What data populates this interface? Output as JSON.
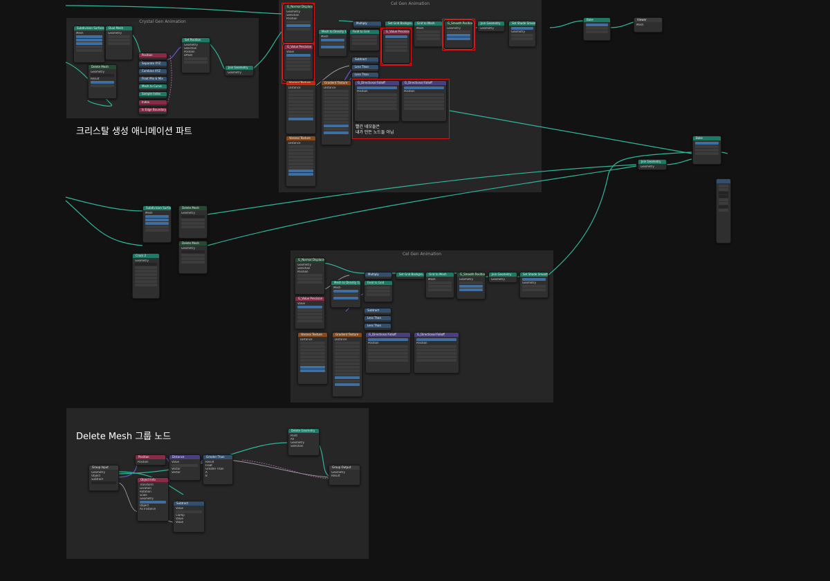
{
  "frames": {
    "crystal": {
      "title": "Crystal Gen Animation"
    },
    "cel_top": {
      "title": "Cel Gen Animation"
    },
    "cel_mid": {
      "title": "Cel Gen Animation"
    },
    "delete_mesh": {
      "title": ""
    }
  },
  "labels": {
    "crystal_caption": "크리스탈 생성 애니메이션 파트",
    "delete_caption": "Delete Mesh 그룹 노드",
    "red_note_line1": "빨간 네모들은",
    "red_note_line2": "내가 만든 노드들 아님"
  },
  "nodes": {
    "subdiv1": "Subdivision Surface",
    "dual_mesh1": "Dual Mesh",
    "delete_mesh1": "Delete Mesh",
    "position1": "Position",
    "separate_xyz": "Separate XYZ",
    "combine_xyz": "Combine XYZ",
    "float_mix": "Float Mix & Mix",
    "mesh_to_curve": "Mesh to Curve",
    "sample_index": "Sample Index",
    "index1": "Index",
    "is_edge_boundary": "Is Edge Boundary",
    "set_position": "Set Position",
    "join_geometry1": "Join Geometry",
    "g_normal_displace_top": "G_Normal Displace",
    "g_value_precision_top": "G_Value Precision",
    "mesh_to_density_top": "Mesh to Density G..",
    "field_to_grid_top": "Field to Grid",
    "g_value_precision2_top": "G_Value Precision",
    "multiply_top": "Multiply",
    "set_grid_background_top": "Set Grid Backgro..",
    "grid_to_mesh_top": "Grid to Mesh",
    "g_smooth_position_top": "G_Smooth Position",
    "join_geometry_top": "Join Geometry",
    "set_shade_smooth_top": "Set Shade Smooth",
    "subtract_top": "Subtract",
    "less_than_top": "Less Than",
    "less_than2_top": "Less Than",
    "g_directional_falloff1": "G_Directional Falloff",
    "g_directional_falloff2": "G_Directional Falloff",
    "voronoi_top": "Voronoi Texture",
    "gradient_top": "Gradient Texture",
    "voronoi2_top": "Voronoi Texture",
    "bake": "Bake",
    "viewer": "Viewer",
    "bake2": "Bake",
    "join_geometry_right": "Join Geometry",
    "subdiv2": "Subdivision Surface",
    "delete_mesh2": "Delete Mesh",
    "crack2": "Crack 2",
    "delete_mesh3": "Delete Mesh",
    "g_normal_displace_mid": "G_Normal Displace",
    "g_value_precision_mid": "G_Value Precision",
    "mesh_to_density_mid": "Mesh to Density G..",
    "field_to_grid_mid": "Field to Grid",
    "multiply_mid": "Multiply",
    "set_grid_background_mid": "Set Grid Backgro..",
    "grid_to_mesh_mid": "Grid to Mesh",
    "g_smooth_position_mid": "G_Smooth Position",
    "join_geometry_mid": "Join Geometry",
    "set_shade_smooth_mid": "Set Shade Smooth",
    "subtract_mid": "Subtract",
    "less_than_mid": "Less Than",
    "less_than2_mid": "Less Than",
    "voronoi_mid": "Voronoi Texture",
    "gradient_mid": "Gradient Texture",
    "g_directional_falloff3": "G_Directional Falloff",
    "g_directional_falloff4": "G_Directional Falloff",
    "group_input": "Group Input",
    "position_dm": "Position",
    "distance_dm": "Distance",
    "greater_than_dm": "Greater Than",
    "delete_geometry_dm": "Delete Geometry",
    "group_output": "Group Output",
    "object_info": "Object Info",
    "subtract_dm": "Subtract"
  },
  "sockets": {
    "geometry": "Geometry",
    "selection": "Selection",
    "position": "Position",
    "offset": "Offset",
    "mesh": "Mesh",
    "result": "Result",
    "value": "Value",
    "distance": "Distance",
    "vector": "Vector",
    "object": "Object",
    "as_instance": "As Instance",
    "transform": "Transform",
    "location": "Location",
    "rotation": "Rotation",
    "scale": "Scale",
    "original": "Original",
    "relative": "Relative",
    "float": "Float",
    "greater_than": "Greater Than",
    "clamp": "Clamp",
    "point": "Point",
    "all": "All",
    "a": "A",
    "b": "B",
    "subtract": "Subtract",
    "mesh_short": "Mesh"
  },
  "colors": {
    "geometry_wire": "#2fb89a",
    "vector_wire": "#6a5fd0",
    "float_wire": "#a0a0a0",
    "selection_box": "#d11111",
    "frame_bg": "#262626",
    "canvas_bg": "#121212"
  }
}
